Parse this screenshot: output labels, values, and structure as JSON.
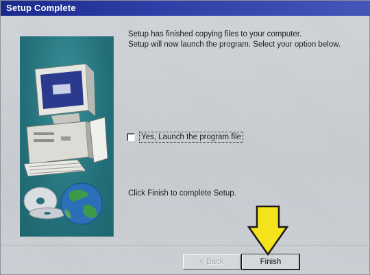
{
  "window": {
    "title": "Setup Complete"
  },
  "content": {
    "message_line1": "Setup has finished copying files to your computer.",
    "message_line2": "Setup will now launch the program. Select your option below.",
    "checkbox_label": "Yes, Launch the program file",
    "checkbox_checked": false,
    "finish_instruction": "Click Finish to complete Setup."
  },
  "buttons": {
    "back_label": "< Back",
    "back_enabled": false,
    "finish_label": "Finish"
  },
  "icons": {
    "computer": "computer-icon",
    "disc": "cd-disc-icon",
    "globe": "globe-icon",
    "arrow": "down-arrow-icon"
  },
  "colors": {
    "titlebar": "#1a2a8c",
    "art_panel": "#23707a",
    "arrow_fill": "#f4e21a"
  }
}
